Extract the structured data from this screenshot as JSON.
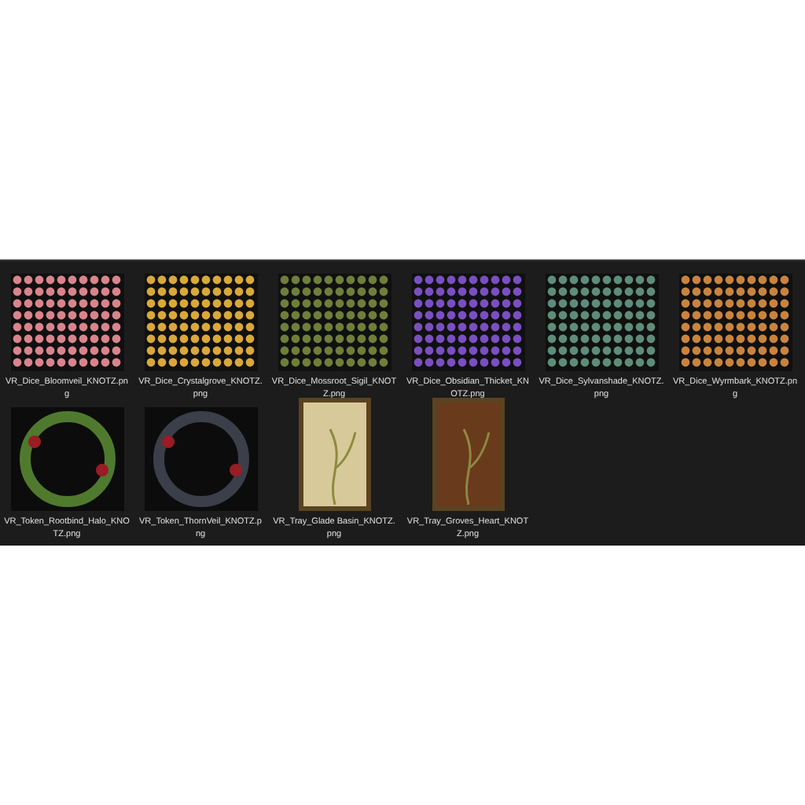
{
  "files": [
    {
      "name": "VR_Dice_Bloomveil_KNOTZ.png",
      "kind": "dice-sheet",
      "color": "#d9848c"
    },
    {
      "name": "VR_Dice_Crystalgrove_KNOTZ.png",
      "kind": "dice-sheet",
      "color": "#d9a83a"
    },
    {
      "name": "VR_Dice_Mossroot_Sigil_KNOTZ.png",
      "kind": "dice-sheet",
      "color": "#6f7e3a"
    },
    {
      "name": "VR_Dice_Obsidian_Thicket_KNOTZ.png",
      "kind": "dice-sheet",
      "color": "#7a4fc0"
    },
    {
      "name": "VR_Dice_Sylvanshade_KNOTZ.png",
      "kind": "dice-sheet",
      "color": "#5f8c7a"
    },
    {
      "name": "VR_Dice_Wyrmbark_KNOTZ.png",
      "kind": "dice-sheet",
      "color": "#c8843e"
    },
    {
      "name": "VR_Token_Rootbind_Halo_KNOTZ.png",
      "kind": "wreath",
      "color": "#4f7a2e"
    },
    {
      "name": "VR_Token_ThornVeil_KNOTZ.png",
      "kind": "wreath",
      "color": "#3a3f4a"
    },
    {
      "name": "VR_Tray_Glade Basin_KNOTZ.png",
      "kind": "tray",
      "color": "#d8c99a"
    },
    {
      "name": "VR_Tray_Groves_Heart_KNOTZ.png",
      "kind": "tray",
      "color": "#6a3a1c"
    }
  ]
}
